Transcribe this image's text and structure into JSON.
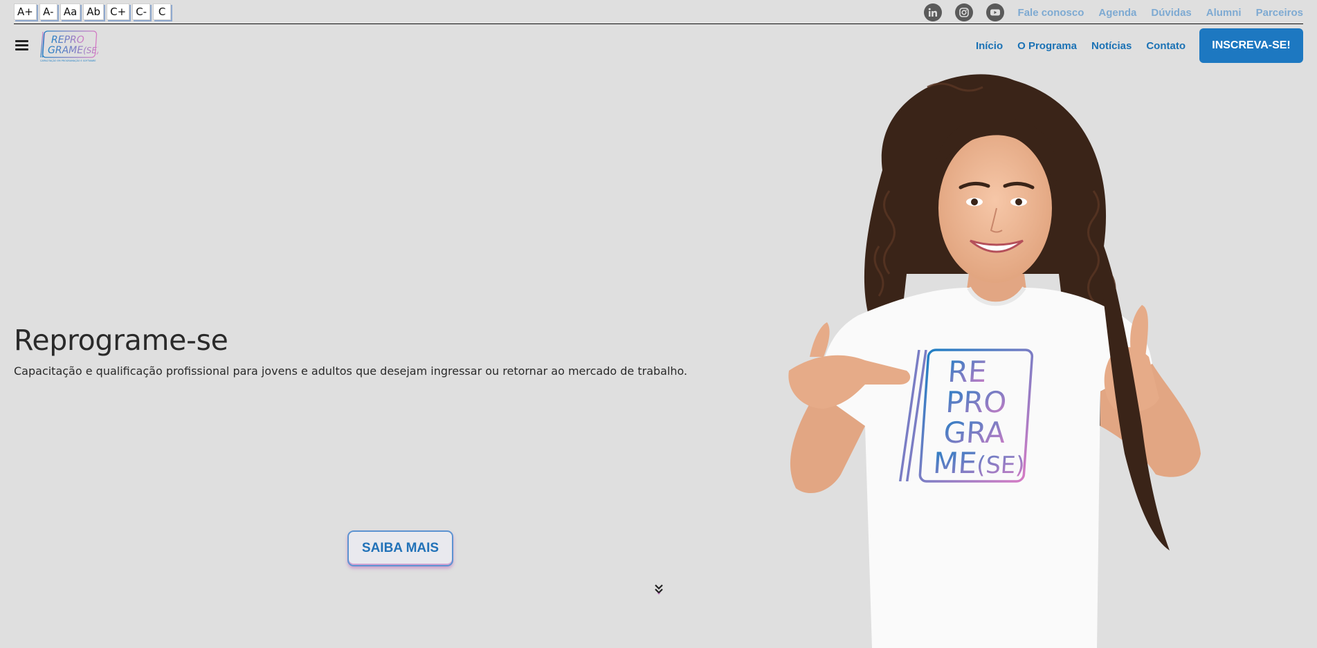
{
  "accessibility": {
    "buttons": [
      "A+",
      "A-",
      "Aa",
      "Ab",
      "C+",
      "C-",
      "C"
    ]
  },
  "social": {
    "icons": [
      "linkedin-icon",
      "instagram-icon",
      "youtube-icon"
    ]
  },
  "top_links": [
    "Fale conosco",
    "Agenda",
    "Dúvidas",
    "Alumni",
    "Parceiros"
  ],
  "logo": {
    "line1": "REPRO",
    "line2": "GRAME",
    "line2_suffix": "(SE)",
    "tagline": "CAPACITAÇÃO EM PROGRAMAÇÃO E SOFTWARE"
  },
  "nav": {
    "links": [
      "Início",
      "O Programa",
      "Notícias",
      "Contato"
    ],
    "cta": "INSCREVA-SE!"
  },
  "hero": {
    "title": "Reprograme-se",
    "subtitle": "Capacitação e qualificação profissional para jovens e adultos que desejam ingressar ou retornar ao mercado de trabalho.",
    "button": "SAIBA MAIS",
    "shirt_lines": [
      "RE",
      "PRO",
      "GRA",
      "ME"
    ],
    "shirt_suffix": "(SE)"
  },
  "colors": {
    "background": "#dfdfdf",
    "primary_blue": "#1d78c1",
    "nav_link": "#1b72b5",
    "top_link": "#7eaad2",
    "gradient_start": "#1f7fc4",
    "gradient_end": "#d57bc4"
  }
}
